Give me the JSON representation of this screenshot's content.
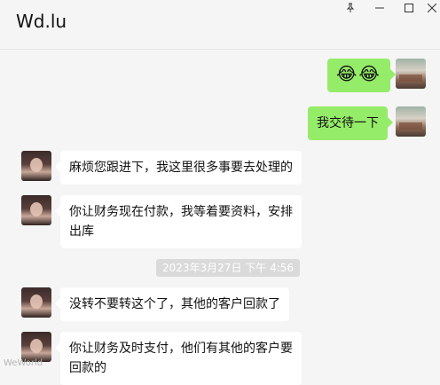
{
  "window": {
    "title": "Wd.lu",
    "controls": [
      "pin-icon",
      "minimize-icon",
      "maximize-icon",
      "close-icon"
    ]
  },
  "messages": [
    {
      "side": "out",
      "type": "emoji",
      "text": "😂😂"
    },
    {
      "side": "out",
      "type": "text",
      "text": "我交待一下"
    },
    {
      "side": "in",
      "type": "text",
      "text": "麻烦您跟进下，我这里很多事要去处理的"
    },
    {
      "side": "in",
      "type": "text",
      "lines": [
        "你让财务现在付款，我等着要资料，安排",
        "出库"
      ]
    },
    {
      "side": "in",
      "type": "text",
      "text": "没转不要转这个了，其他的客户回款了"
    },
    {
      "side": "in",
      "type": "text",
      "lines": [
        "你让财务及时支付，他们有其他的客户要",
        "回款的"
      ]
    }
  ],
  "timestamp": "2023年3月27日 下午 4:56",
  "watermark": "WeWorld",
  "colors": {
    "background": "#f5f5f5",
    "outgoing_bubble": "#95ec69",
    "incoming_bubble": "#ffffff"
  }
}
